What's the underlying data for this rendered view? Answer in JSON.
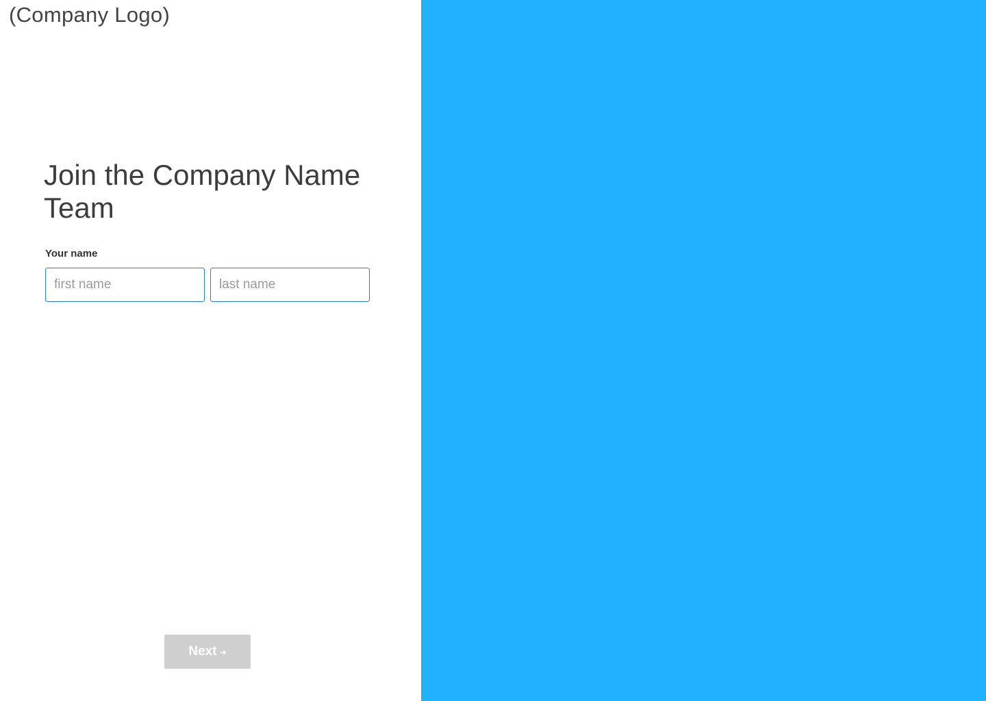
{
  "brand": {
    "logo_text": "(Company Logo)",
    "accent_color": "#20b2fe",
    "input_border_color": "#2a7bd9",
    "button_disabled_color": "#cfcfcf"
  },
  "form": {
    "title": "Join the Company Name Team",
    "name_label": "Your name",
    "first_name_placeholder": "first name",
    "first_name_value": "",
    "last_name_placeholder": "last name",
    "last_name_value": "",
    "next_label": "Next",
    "next_icon": "arrow-right-icon",
    "next_enabled": false
  },
  "side_panel": {
    "background_color": "#20b2fe"
  }
}
